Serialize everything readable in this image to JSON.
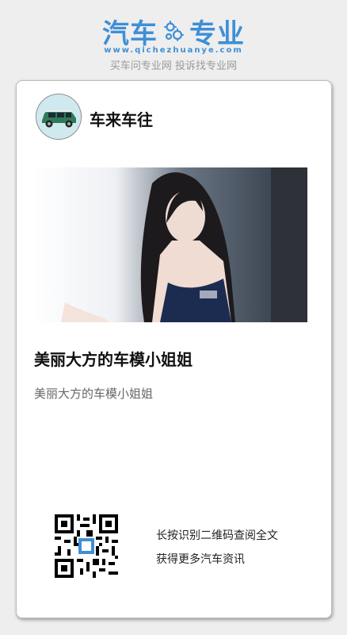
{
  "brand": {
    "left": "汽车",
    "right": "专业",
    "url": "www.qichezhuanye.com",
    "slogan": "买车问专业网 投诉找专业网",
    "color": "#3f8fd6",
    "icon": "gear-icon"
  },
  "card": {
    "author": "车来车往",
    "title": "美丽大方的车模小姐姐",
    "description": "美丽大方的车模小姐姐"
  },
  "footer": {
    "line1": "长按识别二维码查阅全文",
    "line2": "获得更多汽车资讯"
  }
}
